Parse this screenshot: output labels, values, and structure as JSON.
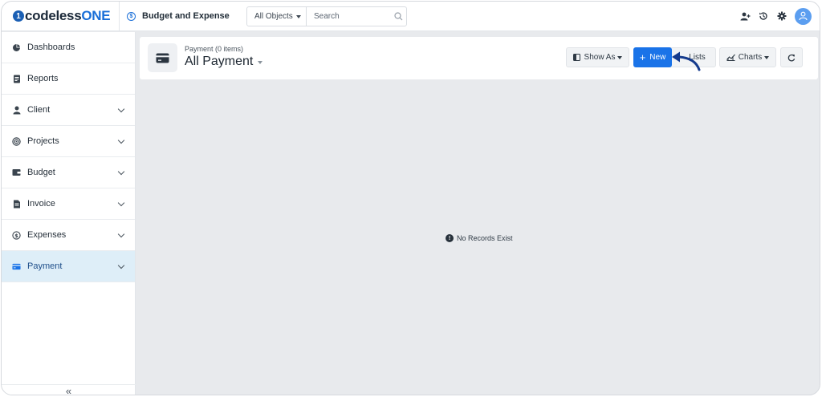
{
  "brand": {
    "name_part1": "codeless",
    "name_part2": "ONE",
    "mark": "1"
  },
  "app": {
    "name": "Budget and Expense",
    "icon": "dollar-circle-icon"
  },
  "search": {
    "scope": "All Objects",
    "placeholder": "Search"
  },
  "sidebar": {
    "items": [
      {
        "label": "Dashboards",
        "icon": "pie-chart-icon",
        "expandable": false,
        "active": false
      },
      {
        "label": "Reports",
        "icon": "report-icon",
        "expandable": false,
        "active": false
      },
      {
        "label": "Client",
        "icon": "person-icon",
        "expandable": true,
        "active": false
      },
      {
        "label": "Projects",
        "icon": "target-icon",
        "expandable": true,
        "active": false
      },
      {
        "label": "Budget",
        "icon": "wallet-icon",
        "expandable": true,
        "active": false
      },
      {
        "label": "Invoice",
        "icon": "invoice-icon",
        "expandable": true,
        "active": false
      },
      {
        "label": "Expenses",
        "icon": "dollar-circle-icon",
        "expandable": true,
        "active": false
      },
      {
        "label": "Payment",
        "icon": "credit-card-icon",
        "expandable": true,
        "active": true
      }
    ],
    "collapse_label": "«"
  },
  "header": {
    "subtitle": "Payment (0 items)",
    "title": "All Payment",
    "show_as_label": "Show As",
    "new_label": "New",
    "lists_label": "Lists",
    "charts_label": "Charts"
  },
  "empty_state": {
    "message": "No Records Exist"
  },
  "colors": {
    "primary": "#1a73e8",
    "active_bg": "#deeef8",
    "brand_blue": "#1a6fd8",
    "canvas": "#e8eaed"
  }
}
